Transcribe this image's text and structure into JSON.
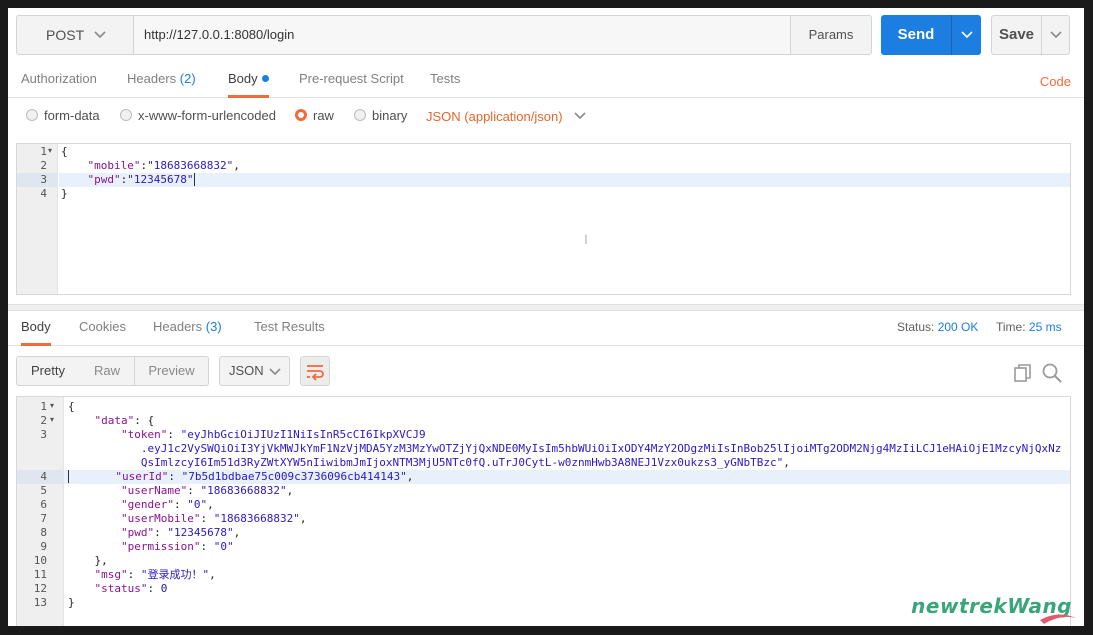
{
  "request": {
    "method": "POST",
    "url": "http://127.0.0.1:8080/login",
    "params_label": "Params",
    "send_label": "Send",
    "save_label": "Save"
  },
  "request_tabs": {
    "authorization": "Authorization",
    "headers": "Headers",
    "headers_count": "(2)",
    "body": "Body",
    "prerequest": "Pre-request Script",
    "tests": "Tests",
    "code": "Code"
  },
  "body_types": {
    "form_data": "form-data",
    "urlencoded": "x-www-form-urlencoded",
    "raw": "raw",
    "binary": "binary",
    "selected": "raw",
    "content_type": "JSON (application/json)"
  },
  "request_body": {
    "line_numbers": [
      "1",
      "2",
      "3",
      "4"
    ],
    "l1": "{",
    "l2_key": "\"mobile\"",
    "l2_val": "\"18683668832\"",
    "l3_key": "\"pwd\"",
    "l3_val": "\"12345678\"",
    "l4": "}"
  },
  "response_tabs": {
    "body": "Body",
    "cookies": "Cookies",
    "headers": "Headers",
    "headers_count": "(3)",
    "test_results": "Test Results",
    "status_label": "Status:",
    "status_value": "200 OK",
    "time_label": "Time:",
    "time_value": "25 ms"
  },
  "view_options": {
    "pretty": "Pretty",
    "raw": "Raw",
    "preview": "Preview",
    "format": "JSON"
  },
  "response_body": {
    "line_numbers": [
      "1",
      "2",
      "3",
      "",
      "",
      "4",
      "5",
      "6",
      "7",
      "8",
      "9",
      "10",
      "11",
      "12",
      "13"
    ],
    "l1": "{",
    "l2_key": "\"data\"",
    "l2_rest": ": {",
    "l3_key": "\"token\"",
    "token_1": "\"eyJhbGciOiJIUzI1NiIsInR5cCI6IkpXVCJ9",
    "token_2": ".eyJ1c2VySWQiOiI3YjVkMWJkYmF1NzVjMDA5YzM3MzYwOTZjYjQxNDE0MyIsIm5hbWUiOiIxODY4MzY2ODgzMiIsInBob25lIjoiMTg2ODM2Njg4MzIiLCJ1eHAiOjE1MzcyNjQxNz",
    "token_3": "QsImlzcyI6Im51d3RyZWtXYW5nIiwibmJmIjoxNTM3MjU5NTc0fQ.uTrJ0CytL-w0znmHwb3A8NEJ1Vzx0ukzs3_yGNbTBzc\"",
    "l4_key": "\"userId\"",
    "l4_val": "\"7b5d1bdbae75c009c3736096cb414143\"",
    "l5_key": "\"userName\"",
    "l5_val": "\"18683668832\"",
    "l6_key": "\"gender\"",
    "l6_val": "\"0\"",
    "l7_key": "\"userMobile\"",
    "l7_val": "\"18683668832\"",
    "l8_key": "\"pwd\"",
    "l8_val": "\"12345678\"",
    "l9_key": "\"permission\"",
    "l9_val": "\"0\"",
    "l10": "},",
    "l11_key": "\"msg\"",
    "l11_val": "\"登录成功！\"",
    "l12_key": "\"status\"",
    "l12_val": "0",
    "l13": "}"
  },
  "watermark": "newtrekWang",
  "colors": {
    "accent": "#f26b3a",
    "primary": "#1b7ee0"
  }
}
